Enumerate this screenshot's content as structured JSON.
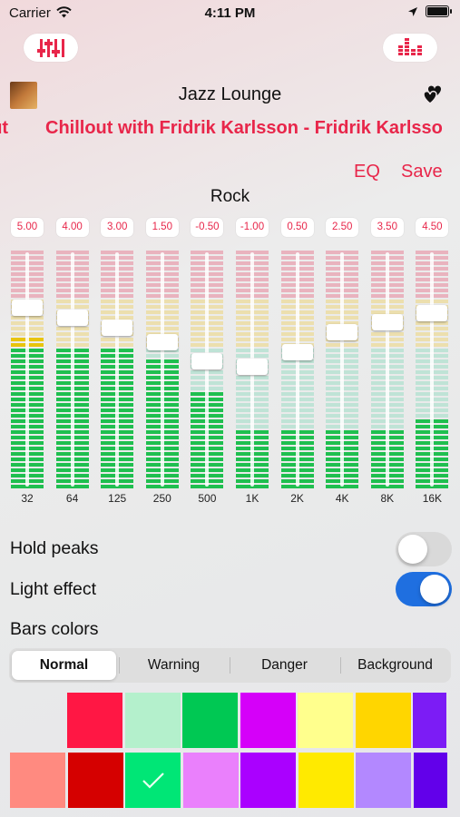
{
  "status_bar": {
    "carrier": "Carrier",
    "time": "4:11 PM"
  },
  "now_playing": {
    "station": "Jazz Lounge",
    "marquee_left_fragment": "out",
    "marquee_text": "Chillout with Fridrik Karlsson - Fridrik Karlsso"
  },
  "actions": {
    "eq_label": "EQ",
    "save_label": "Save"
  },
  "preset_name": "Rock",
  "equalizer": {
    "bands": [
      {
        "freq": "32",
        "gain_label": "5.00",
        "gain": 5.0
      },
      {
        "freq": "64",
        "gain_label": "4.00",
        "gain": 4.0
      },
      {
        "freq": "125",
        "gain_label": "3.00",
        "gain": 3.0
      },
      {
        "freq": "250",
        "gain_label": "1.50",
        "gain": 1.5
      },
      {
        "freq": "500",
        "gain_label": "-0.50",
        "gain": -0.5
      },
      {
        "freq": "1K",
        "gain_label": "-1.00",
        "gain": -1.0
      },
      {
        "freq": "2K",
        "gain_label": "0.50",
        "gain": 0.5
      },
      {
        "freq": "4K",
        "gain_label": "2.50",
        "gain": 2.5
      },
      {
        "freq": "8K",
        "gain_label": "3.50",
        "gain": 3.5
      },
      {
        "freq": "16K",
        "gain_label": "4.50",
        "gain": 4.5
      }
    ],
    "lit_levels": [
      0.64,
      0.6,
      0.58,
      0.55,
      0.4,
      0.25,
      0.25,
      0.25,
      0.25,
      0.29
    ],
    "colors": {
      "normal_on": "#1fbf4f",
      "warning_on": "#e8c40c",
      "danger_on": "#e8264a",
      "normal_off": "#bfe3d6",
      "warning_off": "#ecdfae",
      "danger_off": "#e9b3be"
    }
  },
  "options": {
    "hold_peaks": {
      "label": "Hold peaks",
      "on": false
    },
    "light_effect": {
      "label": "Light effect",
      "on": true
    },
    "bars_colors_label": "Bars colors"
  },
  "segments": {
    "items": [
      "Normal",
      "Warning",
      "Danger",
      "Background"
    ],
    "selected": 0
  },
  "palette": {
    "row1": [
      "#ff1744",
      "#b4f0cc",
      "#00c853",
      "#d500f9",
      "#ffff8d",
      "#ffd600",
      "#7c1cf5"
    ],
    "row2": [
      "#ff8a80",
      "#d50000",
      "#00e676",
      "#ea80fc",
      "#aa00ff",
      "#ffea00",
      "#b388ff",
      "#6200ea"
    ],
    "selected_row2_index": 2
  },
  "icons": [
    "wifi-icon",
    "location-icon",
    "battery-icon",
    "sliders-icon",
    "equalizer-bars-icon",
    "album-art",
    "hearts-icon",
    "checkmark-icon"
  ]
}
